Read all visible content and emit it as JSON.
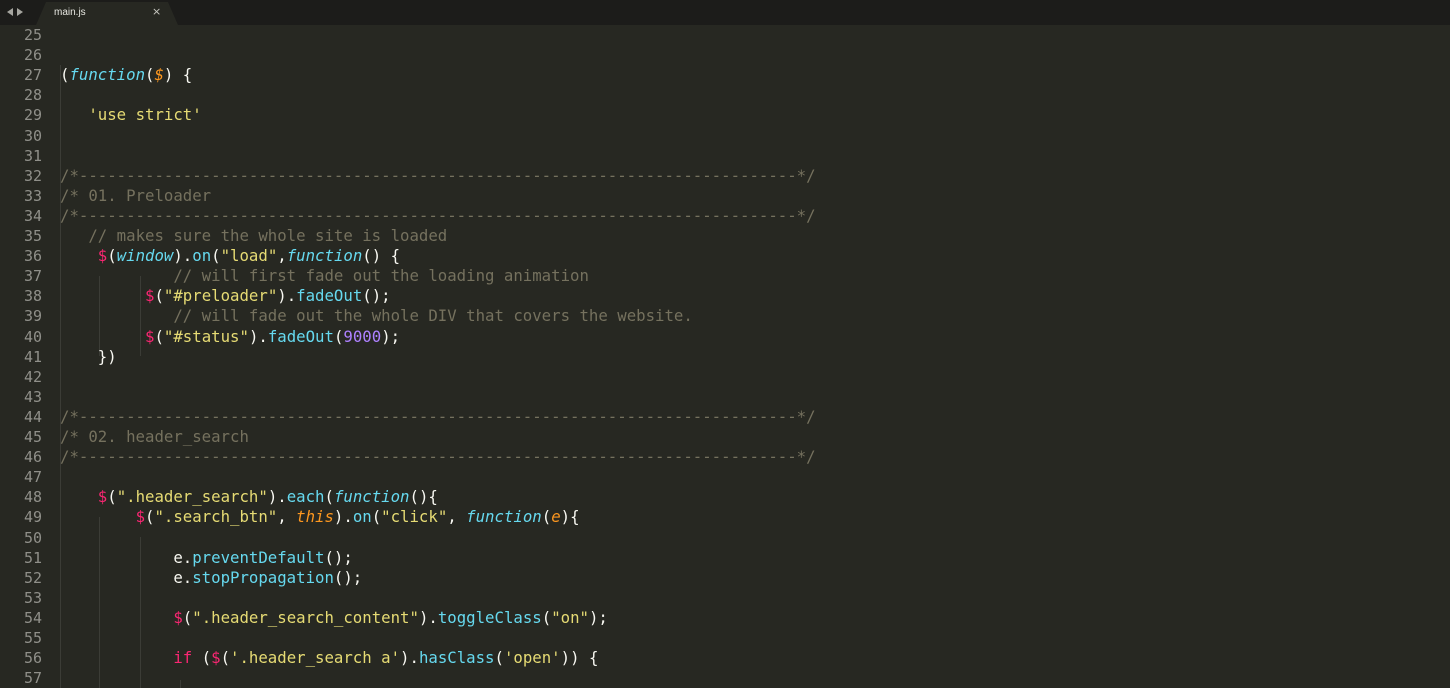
{
  "tabs": [
    {
      "label": "main.js",
      "active": true
    }
  ],
  "icons": {
    "nav_left": "arrow-left-icon",
    "nav_right": "arrow-right-icon",
    "close": "close-icon"
  },
  "close_glyph": "×",
  "colors": {
    "background": "#272822",
    "tabbar": "#1c1c1a",
    "plain": "#f8f8f2",
    "keyword": "#66d9ef",
    "selector": "#f92672",
    "string": "#e6db74",
    "comment": "#75715e",
    "number": "#ae81ff",
    "parameter": "#fd971f",
    "line_number": "#90908a"
  },
  "lines": [
    {
      "n": "25",
      "tokens": []
    },
    {
      "n": "26",
      "tokens": []
    },
    {
      "n": "27",
      "tokens": [
        [
          "t-plain",
          "("
        ],
        [
          "t-kw",
          "function"
        ],
        [
          "t-plain",
          "("
        ],
        [
          "t-param",
          "$"
        ],
        [
          "t-plain",
          ") {"
        ]
      ]
    },
    {
      "n": "28",
      "tokens": []
    },
    {
      "n": "29",
      "tokens": [
        [
          "t-plain",
          "   "
        ],
        [
          "t-str",
          "'use strict'"
        ]
      ]
    },
    {
      "n": "30",
      "tokens": []
    },
    {
      "n": "31",
      "tokens": []
    },
    {
      "n": "32",
      "tokens": [
        [
          "t-cmt",
          "/*----------------------------------------------------------------------------*/"
        ]
      ]
    },
    {
      "n": "33",
      "tokens": [
        [
          "t-cmt",
          "/* 01. Preloader"
        ]
      ]
    },
    {
      "n": "34",
      "tokens": [
        [
          "t-cmt",
          "/*----------------------------------------------------------------------------*/"
        ]
      ]
    },
    {
      "n": "35",
      "tokens": [
        [
          "t-plain",
          "   "
        ],
        [
          "t-cmt",
          "// makes sure the whole site is loaded"
        ]
      ]
    },
    {
      "n": "36",
      "tokens": [
        [
          "t-plain",
          "    "
        ],
        [
          "t-sel",
          "$"
        ],
        [
          "t-plain",
          "("
        ],
        [
          "t-kw",
          "window"
        ],
        [
          "t-plain",
          ")."
        ],
        [
          "t-fn",
          "on"
        ],
        [
          "t-plain",
          "("
        ],
        [
          "t-str",
          "\"load\""
        ],
        [
          "t-plain",
          ","
        ],
        [
          "t-kw",
          "function"
        ],
        [
          "t-plain",
          "() {"
        ]
      ]
    },
    {
      "n": "37",
      "tokens": [
        [
          "t-plain",
          "            "
        ],
        [
          "t-cmt",
          "// will first fade out the loading animation"
        ]
      ]
    },
    {
      "n": "38",
      "tokens": [
        [
          "t-plain",
          "         "
        ],
        [
          "t-sel",
          "$"
        ],
        [
          "t-plain",
          "("
        ],
        [
          "t-str",
          "\"#preloader\""
        ],
        [
          "t-plain",
          ")."
        ],
        [
          "t-fn",
          "fadeOut"
        ],
        [
          "t-plain",
          "();"
        ]
      ]
    },
    {
      "n": "39",
      "tokens": [
        [
          "t-plain",
          "            "
        ],
        [
          "t-cmt",
          "// will fade out the whole DIV that covers the website."
        ]
      ]
    },
    {
      "n": "40",
      "tokens": [
        [
          "t-plain",
          "         "
        ],
        [
          "t-sel",
          "$"
        ],
        [
          "t-plain",
          "("
        ],
        [
          "t-str",
          "\"#status\""
        ],
        [
          "t-plain",
          ")."
        ],
        [
          "t-fn",
          "fadeOut"
        ],
        [
          "t-plain",
          "("
        ],
        [
          "t-num",
          "9000"
        ],
        [
          "t-plain",
          ");"
        ]
      ]
    },
    {
      "n": "41",
      "tokens": [
        [
          "t-plain",
          "    })"
        ]
      ]
    },
    {
      "n": "42",
      "tokens": []
    },
    {
      "n": "43",
      "tokens": []
    },
    {
      "n": "44",
      "tokens": [
        [
          "t-cmt",
          "/*----------------------------------------------------------------------------*/"
        ]
      ]
    },
    {
      "n": "45",
      "tokens": [
        [
          "t-cmt",
          "/* 02. header_search"
        ]
      ]
    },
    {
      "n": "46",
      "tokens": [
        [
          "t-cmt",
          "/*----------------------------------------------------------------------------*/"
        ]
      ]
    },
    {
      "n": "47",
      "tokens": []
    },
    {
      "n": "48",
      "tokens": [
        [
          "t-plain",
          "    "
        ],
        [
          "t-sel",
          "$"
        ],
        [
          "t-plain",
          "("
        ],
        [
          "t-str",
          "\".header_search\""
        ],
        [
          "t-plain",
          ")."
        ],
        [
          "t-fn",
          "each"
        ],
        [
          "t-plain",
          "("
        ],
        [
          "t-kw",
          "function"
        ],
        [
          "t-plain",
          "(){"
        ]
      ]
    },
    {
      "n": "49",
      "tokens": [
        [
          "t-plain",
          "        "
        ],
        [
          "t-sel",
          "$"
        ],
        [
          "t-plain",
          "("
        ],
        [
          "t-str",
          "\".search_btn\""
        ],
        [
          "t-plain",
          ", "
        ],
        [
          "t-param",
          "this"
        ],
        [
          "t-plain",
          ")."
        ],
        [
          "t-fn",
          "on"
        ],
        [
          "t-plain",
          "("
        ],
        [
          "t-str",
          "\"click\""
        ],
        [
          "t-plain",
          ", "
        ],
        [
          "t-kw",
          "function"
        ],
        [
          "t-plain",
          "("
        ],
        [
          "t-param",
          "e"
        ],
        [
          "t-plain",
          "){"
        ]
      ]
    },
    {
      "n": "50",
      "tokens": []
    },
    {
      "n": "51",
      "tokens": [
        [
          "t-plain",
          "            e."
        ],
        [
          "t-fn",
          "preventDefault"
        ],
        [
          "t-plain",
          "();"
        ]
      ]
    },
    {
      "n": "52",
      "tokens": [
        [
          "t-plain",
          "            e."
        ],
        [
          "t-fn",
          "stopPropagation"
        ],
        [
          "t-plain",
          "();"
        ]
      ]
    },
    {
      "n": "53",
      "tokens": []
    },
    {
      "n": "54",
      "tokens": [
        [
          "t-plain",
          "            "
        ],
        [
          "t-sel",
          "$"
        ],
        [
          "t-plain",
          "("
        ],
        [
          "t-str",
          "\".header_search_content\""
        ],
        [
          "t-plain",
          ")."
        ],
        [
          "t-fn",
          "toggleClass"
        ],
        [
          "t-plain",
          "("
        ],
        [
          "t-str",
          "\"on\""
        ],
        [
          "t-plain",
          ");"
        ]
      ]
    },
    {
      "n": "55",
      "tokens": []
    },
    {
      "n": "56",
      "tokens": [
        [
          "t-plain",
          "            "
        ],
        [
          "t-ctl",
          "if"
        ],
        [
          "t-plain",
          " ("
        ],
        [
          "t-sel",
          "$"
        ],
        [
          "t-plain",
          "("
        ],
        [
          "t-str",
          "'.header_search a'"
        ],
        [
          "t-plain",
          ")."
        ],
        [
          "t-fn",
          "hasClass"
        ],
        [
          "t-plain",
          "("
        ],
        [
          "t-str",
          "'open'"
        ],
        [
          "t-plain",
          ")) {"
        ]
      ]
    },
    {
      "n": "57",
      "tokens": []
    }
  ]
}
